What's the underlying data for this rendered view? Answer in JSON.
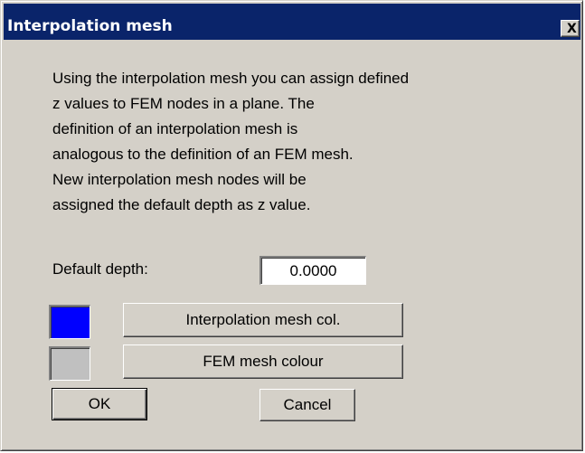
{
  "window": {
    "title": "Interpolation mesh",
    "close_label": "X"
  },
  "description": {
    "lines": [
      "Using the interpolation mesh you can assign defined",
      "z values to FEM nodes in a plane. The",
      "definition of an interpolation mesh is",
      "analogous to the definition of an FEM mesh.",
      "New interpolation mesh nodes will be",
      "assigned the default depth as z value."
    ]
  },
  "default_depth": {
    "label": "Default depth:",
    "value": "0.0000"
  },
  "colours": {
    "interpolation_mesh": {
      "button_label": "Interpolation mesh col.",
      "swatch_color": "#0000ff"
    },
    "fem_mesh": {
      "button_label": "FEM mesh colour",
      "swatch_color": "#c0c0c0"
    }
  },
  "buttons": {
    "ok_label": "OK",
    "cancel_label": "Cancel"
  },
  "theme": {
    "titlebar_color": "#0a246a",
    "face_color": "#d4d0c8"
  }
}
